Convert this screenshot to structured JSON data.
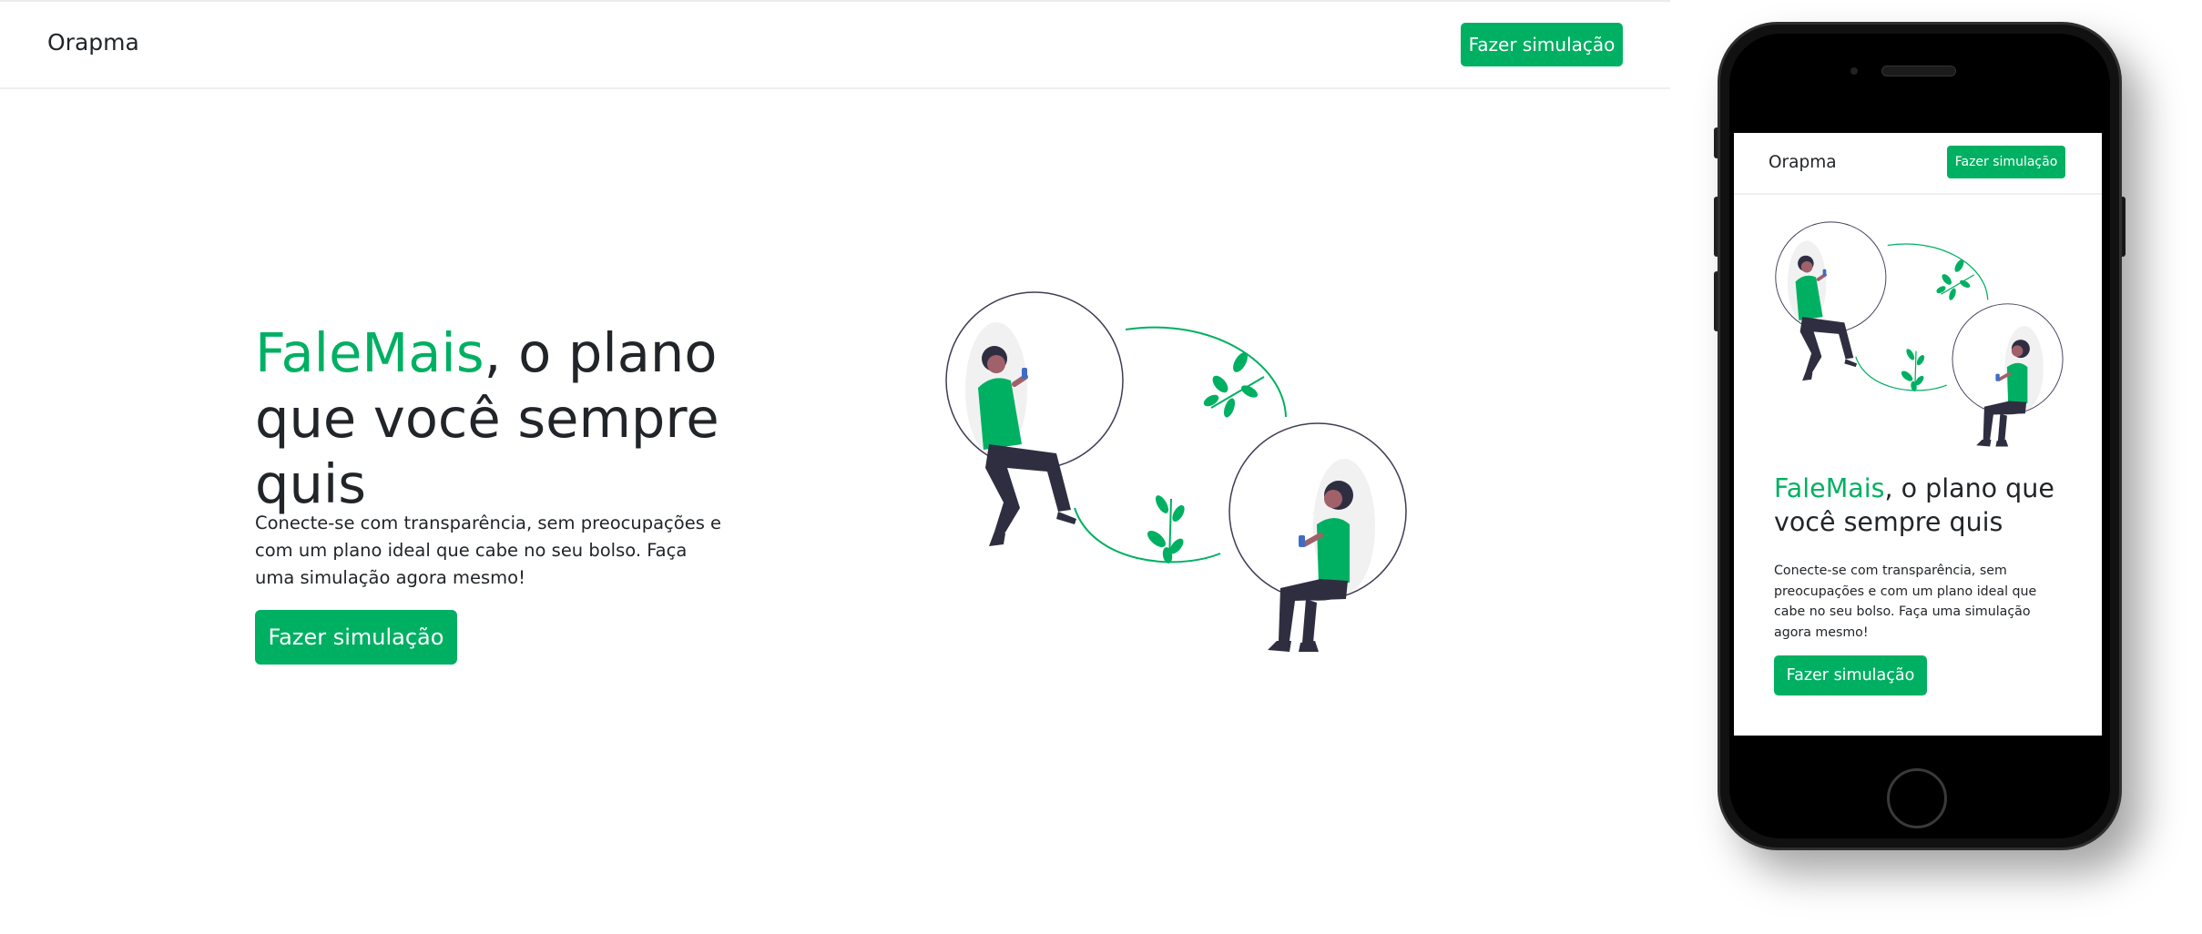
{
  "brand": {
    "name": "Orapma",
    "accent_color": "#00b062"
  },
  "navbar": {
    "cta_label": "Fazer simulação"
  },
  "hero": {
    "title_accent": "FaleMais",
    "title_rest": ", o plano que você sempre quis",
    "description": "Conecte-se com transparência, sem preocupações e com um plano ideal que cabe no seu bolso. Faça uma simulação agora mesmo!",
    "cta_label": "Fazer simulação",
    "illustration_icon": "people-bubbles-illustration"
  },
  "mobile_preview": {
    "brand": "Orapma",
    "nav_cta_label": "Fazer simulação",
    "title_accent": "FaleMais",
    "title_rest": ", o plano que você sempre quis",
    "description": "Conecte-se com transparência, sem preocupações e com um plano ideal que cabe no seu bolso. Faça uma simulação agora mesmo!",
    "cta_label": "Fazer simulação"
  }
}
